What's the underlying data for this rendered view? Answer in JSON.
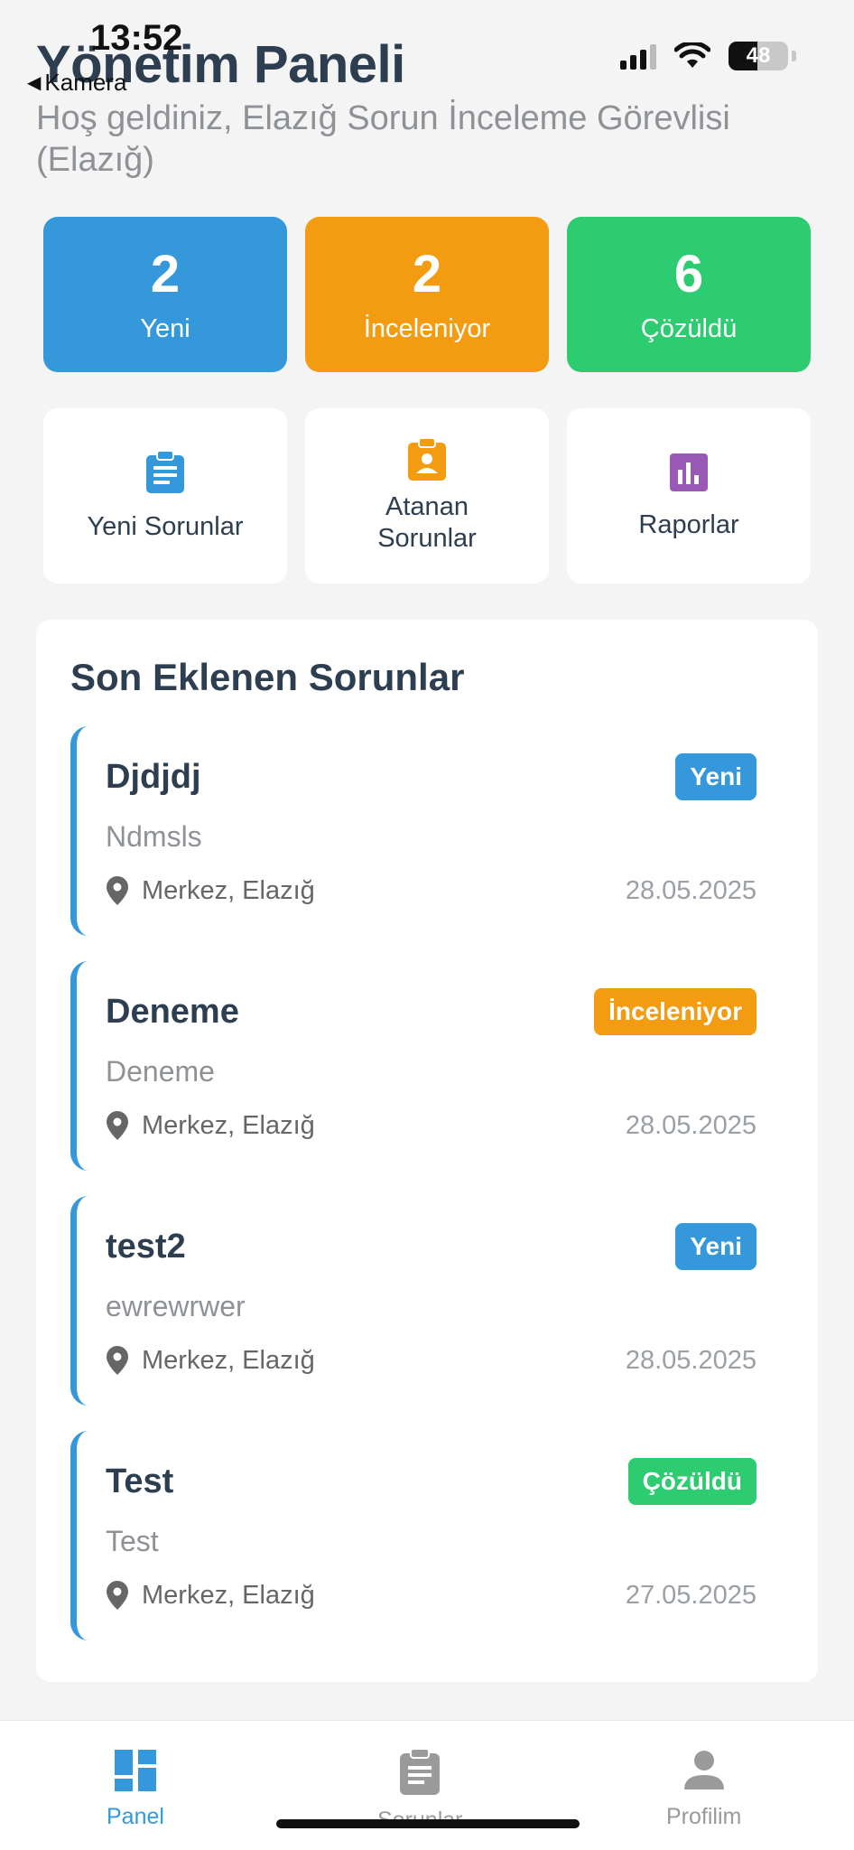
{
  "status_bar": {
    "time": "13:52",
    "back_label": "Kamera",
    "battery": "48"
  },
  "header": {
    "title": "Yönetim Paneli",
    "subtitle": "Hoş geldiniz, Elazığ Sorun İnceleme Görevlisi (Elazığ)"
  },
  "stats": [
    {
      "value": "2",
      "label": "Yeni",
      "color": "#3498db"
    },
    {
      "value": "2",
      "label": "İnceleniyor",
      "color": "#f39c12"
    },
    {
      "value": "6",
      "label": "Çözüldü",
      "color": "#2ecc71"
    }
  ],
  "actions": [
    {
      "label": "Yeni Sorunlar",
      "icon": "clipboard-list-icon",
      "color": "#3498db"
    },
    {
      "label": "Atanan Sorunlar",
      "icon": "clipboard-user-icon",
      "color": "#f39c12"
    },
    {
      "label": "Raporlar",
      "icon": "bar-chart-icon",
      "color": "#9b59b6"
    }
  ],
  "recent": {
    "title": "Son Eklenen Sorunlar",
    "items": [
      {
        "title": "Djdjdj",
        "status": "Yeni",
        "desc": "Ndmsls",
        "location": "Merkez, Elazığ",
        "date": "28.05.2025"
      },
      {
        "title": "Deneme",
        "status": "İnceleniyor",
        "desc": "Deneme",
        "location": "Merkez, Elazığ",
        "date": "28.05.2025"
      },
      {
        "title": "test2",
        "status": "Yeni",
        "desc": "ewrewrwer",
        "location": "Merkez, Elazığ",
        "date": "28.05.2025"
      },
      {
        "title": "Test",
        "status": "Çözüldü",
        "desc": "Test",
        "location": "Merkez, Elazığ",
        "date": "27.05.2025"
      }
    ]
  },
  "bottom_nav": [
    {
      "label": "Panel",
      "icon": "dashboard-icon",
      "active": true
    },
    {
      "label": "Sorunlar",
      "icon": "clipboard-icon",
      "active": false
    },
    {
      "label": "Profilim",
      "icon": "person-icon",
      "active": false
    }
  ],
  "colors": {
    "accent": "#3498db",
    "background": "#f4f4f5",
    "text": "#2c3e50"
  }
}
